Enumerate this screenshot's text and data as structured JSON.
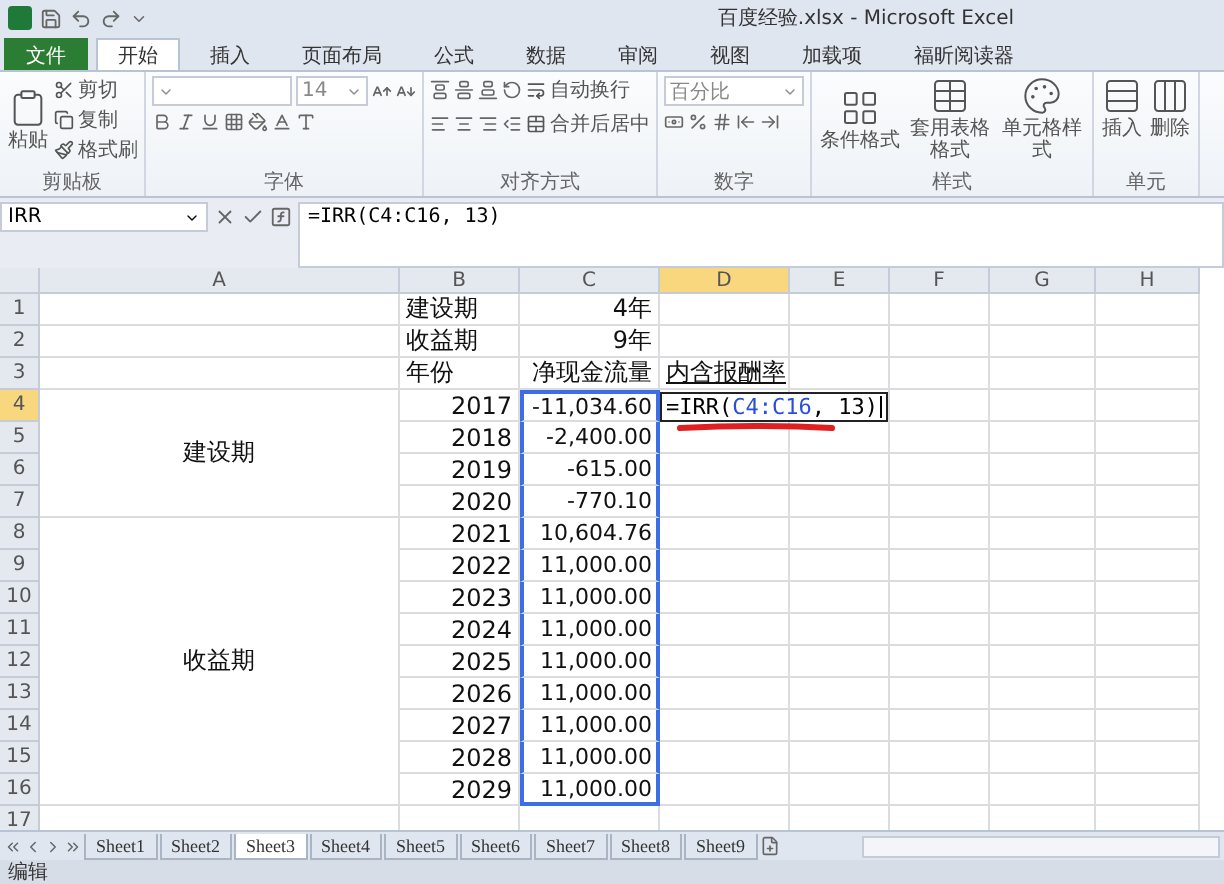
{
  "window": {
    "title": "百度经验.xlsx - Microsoft Excel"
  },
  "ribbon_tabs": [
    {
      "label": "文件",
      "kind": "file",
      "selected": false
    },
    {
      "label": "开始",
      "kind": "tab",
      "selected": true
    },
    {
      "label": "插入",
      "kind": "tab",
      "selected": false
    },
    {
      "label": "页面布局",
      "kind": "tab",
      "selected": false
    },
    {
      "label": "公式",
      "kind": "tab",
      "selected": false
    },
    {
      "label": "数据",
      "kind": "tab",
      "selected": false
    },
    {
      "label": "审阅",
      "kind": "tab",
      "selected": false
    },
    {
      "label": "视图",
      "kind": "tab",
      "selected": false
    },
    {
      "label": "加载项",
      "kind": "tab",
      "selected": false
    },
    {
      "label": "福昕阅读器",
      "kind": "tab",
      "selected": false
    }
  ],
  "ribbon_groups": [
    {
      "label": "剪贴板",
      "rows": [
        [
          {
            "kind": "large",
            "label": "粘贴"
          },
          {
            "kind": "stack",
            "items": [
              {
                "kind": "small",
                "label": "剪切"
              },
              {
                "kind": "small",
                "label": "复制"
              },
              {
                "kind": "small",
                "label": "格式刷"
              }
            ]
          }
        ]
      ]
    },
    {
      "label": "字体",
      "rows": [
        [
          {
            "kind": "font_select"
          },
          {
            "kind": "select",
            "value": "14"
          },
          {
            "kind": "icon"
          },
          {
            "kind": "icon"
          }
        ],
        [
          {
            "kind": "icon"
          },
          {
            "kind": "icon"
          },
          {
            "kind": "icon"
          },
          {
            "kind": "icon"
          },
          {
            "kind": "icon"
          },
          {
            "kind": "icon"
          },
          {
            "kind": "icon"
          }
        ]
      ]
    },
    {
      "label": "对齐方式",
      "rows": [
        [
          {
            "kind": "icon"
          },
          {
            "kind": "icon"
          },
          {
            "kind": "icon"
          },
          {
            "kind": "icon"
          },
          {
            "kind": "small",
            "label": "自动换行"
          }
        ],
        [
          {
            "kind": "icon"
          },
          {
            "kind": "icon"
          },
          {
            "kind": "icon"
          },
          {
            "kind": "icon"
          },
          {
            "kind": "small",
            "label": "合并后居中"
          }
        ]
      ]
    },
    {
      "label": "数字",
      "rows": [
        [
          {
            "kind": "select",
            "value": "百分比"
          }
        ],
        [
          {
            "kind": "icon"
          },
          {
            "kind": "icon"
          },
          {
            "kind": "icon"
          },
          {
            "kind": "icon"
          },
          {
            "kind": "icon"
          }
        ]
      ]
    },
    {
      "label": "样式",
      "rows": [
        [
          {
            "kind": "large",
            "label": "条件格式"
          },
          {
            "kind": "large",
            "label": "套用表格格式"
          },
          {
            "kind": "large",
            "label": "单元格样式"
          }
        ]
      ]
    },
    {
      "label": "单元",
      "rows": [
        [
          {
            "kind": "large",
            "label": "插入"
          },
          {
            "kind": "large",
            "label": "删除"
          }
        ]
      ]
    }
  ],
  "formula_bar": {
    "name_box": "IRR",
    "formula": "=IRR(C4:C16, 13)"
  },
  "columns": [
    {
      "label": "A",
      "selected": false
    },
    {
      "label": "B",
      "selected": false
    },
    {
      "label": "C",
      "selected": false
    },
    {
      "label": "D",
      "selected": true
    },
    {
      "label": "E",
      "selected": false
    },
    {
      "label": "F",
      "selected": false
    },
    {
      "label": "G",
      "selected": false
    },
    {
      "label": "H",
      "selected": false
    }
  ],
  "top_rows": [
    {
      "num": "1",
      "selected": false,
      "b": "建设期",
      "c": "4年"
    },
    {
      "num": "2",
      "selected": false,
      "b": "收益期",
      "c": "9年"
    },
    {
      "num": "3",
      "selected": false,
      "b": "年份",
      "c": "净现金流量",
      "d": "内含报酬率"
    }
  ],
  "sections": [
    {
      "label": "建设期",
      "rows": [
        {
          "num": "4",
          "selected": true,
          "b": "2017",
          "c": "-11,034.60",
          "referenced": true,
          "edit": {
            "prefix": "=IRR(",
            "ref": "C4:C16",
            "suffix": ", 13)"
          }
        },
        {
          "num": "5",
          "selected": false,
          "b": "2018",
          "c": "-2,400.00",
          "referenced": true
        },
        {
          "num": "6",
          "selected": false,
          "b": "2019",
          "c": "-615.00",
          "referenced": true
        },
        {
          "num": "7",
          "selected": false,
          "b": "2020",
          "c": "-770.10",
          "referenced": true
        }
      ]
    },
    {
      "label": "收益期",
      "rows": [
        {
          "num": "8",
          "selected": false,
          "b": "2021",
          "c": "10,604.76",
          "referenced": true
        },
        {
          "num": "9",
          "selected": false,
          "b": "2022",
          "c": "11,000.00",
          "referenced": true
        },
        {
          "num": "10",
          "selected": false,
          "b": "2023",
          "c": "11,000.00",
          "referenced": true
        },
        {
          "num": "11",
          "selected": false,
          "b": "2024",
          "c": "11,000.00",
          "referenced": true
        },
        {
          "num": "12",
          "selected": false,
          "b": "2025",
          "c": "11,000.00",
          "referenced": true
        },
        {
          "num": "13",
          "selected": false,
          "b": "2026",
          "c": "11,000.00",
          "referenced": true
        },
        {
          "num": "14",
          "selected": false,
          "b": "2027",
          "c": "11,000.00",
          "referenced": true
        },
        {
          "num": "15",
          "selected": false,
          "b": "2028",
          "c": "11,000.00",
          "referenced": true
        },
        {
          "num": "16",
          "selected": false,
          "b": "2029",
          "c": "11,000.00",
          "referenced": true
        }
      ]
    }
  ],
  "tail_rows": [
    {
      "num": "17",
      "selected": false
    }
  ],
  "sheet_tabs": [
    {
      "label": "Sheet1",
      "selected": false
    },
    {
      "label": "Sheet2",
      "selected": false
    },
    {
      "label": "Sheet3",
      "selected": true
    },
    {
      "label": "Sheet4",
      "selected": false
    },
    {
      "label": "Sheet5",
      "selected": false
    },
    {
      "label": "Sheet6",
      "selected": false
    },
    {
      "label": "Sheet7",
      "selected": false
    },
    {
      "label": "Sheet8",
      "selected": false
    },
    {
      "label": "Sheet9",
      "selected": false
    }
  ],
  "status_bar": {
    "mode": "编辑"
  }
}
